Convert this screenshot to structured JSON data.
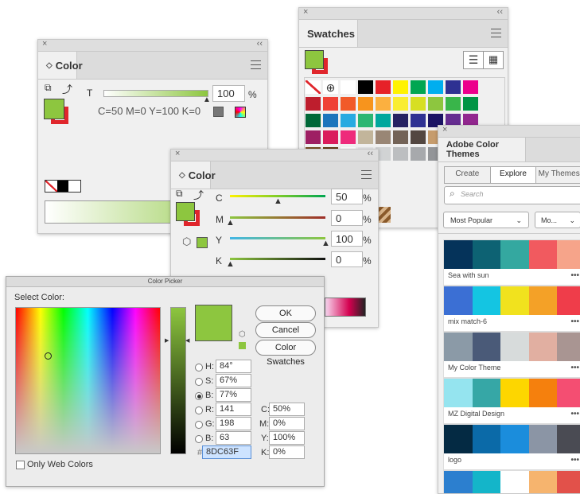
{
  "panel_color_top": {
    "close": "×",
    "collapse": "‹‹",
    "tab": "Color",
    "t_label": "T",
    "t_value": "100",
    "percent": "%",
    "formula": "C=50 M=0 Y=100 K=0",
    "tint_level": 1.0
  },
  "panel_swatches": {
    "close": "×",
    "collapse": "‹‹",
    "tab": "Swatches",
    "grid": [
      [
        "none",
        "reg",
        "#ffffff",
        "#000000",
        "#e62128",
        "#fff200",
        "#00a651",
        "#00aeef",
        "#2e3192",
        "#ec008c"
      ],
      [
        "#be1e2d",
        "#ef4136",
        "#f15a29",
        "#f7941d",
        "#fbb040",
        "#f9ed32",
        "#d7df23",
        "#8dc63f",
        "#39b54a",
        "#009444"
      ],
      [
        "#006838",
        "#1c75bc",
        "#27aae1",
        "#2bb673",
        "#00a79d",
        "#262262",
        "#2e3192",
        "#1b1464",
        "#662d91",
        "#92278f"
      ],
      [
        "#9e1f63",
        "#da1c5c",
        "#ee2a7b",
        "#c2b59b",
        "#998675",
        "#736357",
        "#534741",
        "#c69c6d",
        "#a67c52",
        "#8c6239"
      ],
      [
        "#754c24",
        "#603813",
        "#ffffff",
        "#e6e7e8",
        "#d1d3d4",
        "#bcbec0",
        "#a7a9ac",
        "#939598",
        "#808285",
        "#6d6e71"
      ]
    ]
  },
  "panel_color_mid": {
    "close": "×",
    "collapse": "‹‹",
    "tab": "Color",
    "channels": [
      {
        "label": "C",
        "value": "50",
        "level": 0.5
      },
      {
        "label": "M",
        "value": "0",
        "level": 0.0
      },
      {
        "label": "Y",
        "value": "100",
        "level": 1.0
      },
      {
        "label": "K",
        "value": "0",
        "level": 0.0
      }
    ],
    "percent": "%"
  },
  "color_picker": {
    "title": "Color Picker",
    "select_color": "Select Color:",
    "ok": "OK",
    "cancel": "Cancel",
    "swatches": "Color Swatches",
    "only_web": "Only Web Colors",
    "fields": {
      "h_label": "H:",
      "h": "84°",
      "s_label": "S:",
      "s": "67%",
      "b_label": "B:",
      "b": "77%",
      "r_label": "R:",
      "r": "141",
      "g_label": "G:",
      "g": "198",
      "b2_label": "B:",
      "b2": "63",
      "c_label": "C:",
      "c": "50%",
      "m_label": "M:",
      "m": "0%",
      "y_label": "Y:",
      "y": "100%",
      "k_label": "K:",
      "k": "0%",
      "hash": "#",
      "hex": "8DC63F"
    },
    "current_color": "#8dc63f"
  },
  "adobe_themes": {
    "close": "×",
    "tab": "Adobe Color Themes",
    "subtabs": [
      "Create",
      "Explore",
      "My Themes"
    ],
    "search_placeholder": "Search",
    "sort": "Most Popular",
    "filter": "Mo...",
    "more": "•••",
    "themes": [
      {
        "name": "Sea with sun",
        "colors": [
          "#05335a",
          "#0d6273",
          "#34a8a0",
          "#f15a5f",
          "#f6a48a"
        ]
      },
      {
        "name": "mix match-6",
        "colors": [
          "#3b6fd4",
          "#14c5e2",
          "#f1e21e",
          "#f4a127",
          "#ef3d4a"
        ]
      },
      {
        "name": "My Color Theme",
        "colors": [
          "#8b9aa7",
          "#4a5a78",
          "#d7dbdb",
          "#e1afa1",
          "#a99592"
        ]
      },
      {
        "name": "MZ Digital Design",
        "colors": [
          "#95e4ef",
          "#36a7a6",
          "#fdd600",
          "#f5800d",
          "#f44e72"
        ]
      },
      {
        "name": "logo",
        "colors": [
          "#042a43",
          "#0b6aa8",
          "#1b8ddc",
          "#8b95a5",
          "#4a4b53"
        ]
      },
      {
        "name": "",
        "colors": [
          "#2c7fcf",
          "#14b5c9",
          "#ffffff",
          "#f6b46e",
          "#e2514a"
        ]
      }
    ]
  }
}
